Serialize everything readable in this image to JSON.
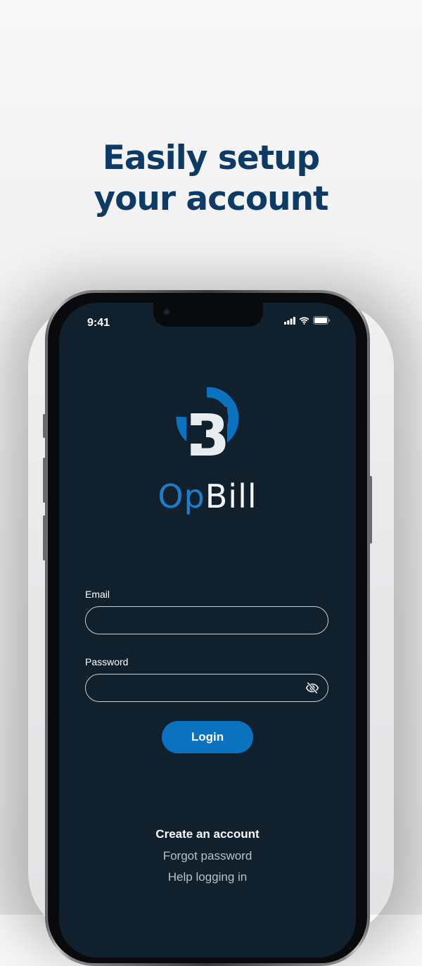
{
  "headline": {
    "line1": "Easily setup",
    "line2": "your account"
  },
  "status_bar": {
    "time": "9:41",
    "icons": [
      "cellular-signal-icon",
      "wifi-icon",
      "battery-icon"
    ]
  },
  "brand": {
    "logo_letter": "B",
    "name_part1": "Op",
    "name_part2": "Bill",
    "colors": {
      "blue": "#1d7fcc",
      "white": "#f2f4f6"
    }
  },
  "form": {
    "email_label": "Email",
    "email_value": "",
    "password_label": "Password",
    "password_value": "",
    "password_toggle_icon": "eye-off-icon",
    "login_label": "Login"
  },
  "links": {
    "create_account": "Create an account",
    "forgot_password": "Forgot password",
    "help_login": "Help logging in"
  },
  "colors": {
    "screen_bg": "#10202d",
    "accent": "#0b72bf",
    "headline": "#0e3a66"
  }
}
